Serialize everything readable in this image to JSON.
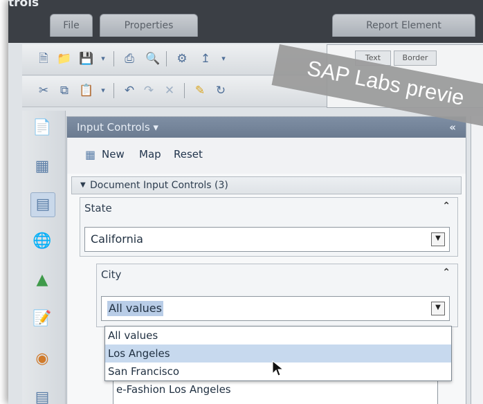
{
  "app": {
    "title": "trols"
  },
  "tabs": {
    "file": "File",
    "properties": "Properties",
    "report_element": "Report Element"
  },
  "report_panel": {
    "tab_text": "Text",
    "tab_border": "Border"
  },
  "panel": {
    "title": "Input Controls ▾",
    "collapse": "«",
    "toolbar": {
      "new_label": "New",
      "map_label": "Map",
      "reset_label": "Reset"
    },
    "doc_section_label": "Document Input Controls (3)"
  },
  "controls": {
    "state": {
      "label": "State",
      "value": "California"
    },
    "city": {
      "label": "City",
      "value": "All values"
    }
  },
  "dropdown": {
    "options": [
      "All values",
      "Los Angeles",
      "San Francisco"
    ],
    "highlighted": "Los Angeles"
  },
  "list": {
    "item": "e-Fashion Los Angeles"
  },
  "watermark": {
    "text": "SAP Labs previe"
  },
  "icons": {
    "toolbar1": [
      "new-document-icon",
      "open-folder-icon",
      "save-icon",
      "print-icon",
      "find-icon",
      "track-changes-icon",
      "export-icon"
    ],
    "toolbar2": [
      "cut-icon",
      "copy-icon",
      "paste-icon",
      "undo-icon",
      "redo-icon",
      "delete-icon",
      "format-painter-icon",
      "refresh-icon"
    ],
    "sidebar": [
      "report-icon",
      "structure-icon",
      "input-controls-icon",
      "globe-icon",
      "export-icon",
      "document-edit-icon",
      "filter-icon",
      "list-icon"
    ]
  }
}
